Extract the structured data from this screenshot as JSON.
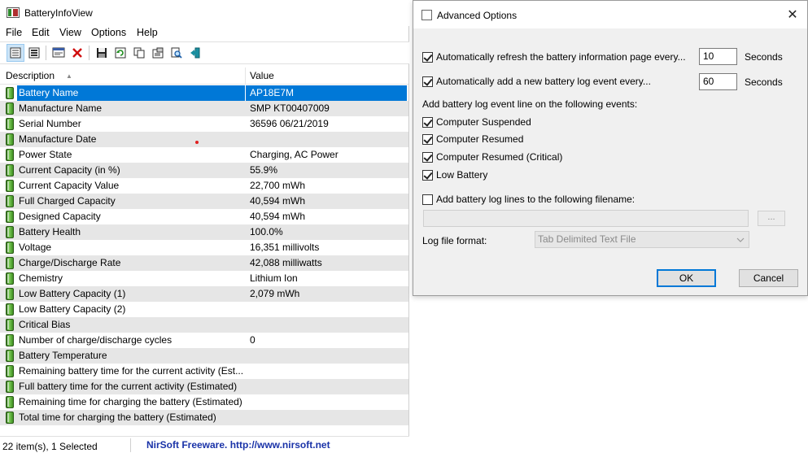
{
  "main_window": {
    "title": "BatteryInfoView",
    "menu": [
      "File",
      "Edit",
      "View",
      "Options",
      "Help"
    ],
    "toolbar_icons": [
      "properties-view-icon",
      "list-view-icon",
      "html-report-icon",
      "delete-icon",
      "save-icon",
      "refresh-icon",
      "copy-icon",
      "properties-icon",
      "find-icon",
      "exit-icon"
    ],
    "columns": {
      "description": "Description",
      "value": "Value"
    },
    "rows": [
      {
        "desc": "Battery Name",
        "value": "AP18E7M"
      },
      {
        "desc": "Manufacture Name",
        "value": "SMP KT00407009"
      },
      {
        "desc": "Serial Number",
        "value": "36596 06/21/2019"
      },
      {
        "desc": "Manufacture Date",
        "value": ""
      },
      {
        "desc": "Power State",
        "value": "Charging, AC Power"
      },
      {
        "desc": "Current Capacity (in %)",
        "value": "55.9%"
      },
      {
        "desc": "Current Capacity Value",
        "value": "22,700 mWh"
      },
      {
        "desc": "Full Charged Capacity",
        "value": "40,594 mWh"
      },
      {
        "desc": "Designed Capacity",
        "value": "40,594 mWh"
      },
      {
        "desc": "Battery Health",
        "value": "100.0%"
      },
      {
        "desc": "Voltage",
        "value": "16,351 millivolts"
      },
      {
        "desc": "Charge/Discharge Rate",
        "value": "42,088 milliwatts"
      },
      {
        "desc": "Chemistry",
        "value": "Lithium Ion"
      },
      {
        "desc": "Low Battery Capacity (1)",
        "value": "2,079 mWh"
      },
      {
        "desc": "Low Battery Capacity (2)",
        "value": ""
      },
      {
        "desc": "Critical Bias",
        "value": ""
      },
      {
        "desc": "Number of charge/discharge cycles",
        "value": "0"
      },
      {
        "desc": "Battery Temperature",
        "value": ""
      },
      {
        "desc": "Remaining battery time for the current activity (Est...",
        "value": ""
      },
      {
        "desc": "Full battery time for the current activity (Estimated)",
        "value": ""
      },
      {
        "desc": "Remaining time for charging the battery (Estimated)",
        "value": ""
      },
      {
        "desc": "Total  time for charging the battery (Estimated)",
        "value": ""
      }
    ],
    "selected_row": 0,
    "status": {
      "items": "22 item(s), 1 Selected",
      "link": "NirSoft Freeware.  http://www.nirsoft.net"
    }
  },
  "dialog": {
    "title": "Advanced Options",
    "auto_refresh": {
      "label": "Automatically refresh the battery information page every...",
      "checked": true,
      "value": "10",
      "unit": "Seconds"
    },
    "auto_log": {
      "label": "Automatically add a new battery log  event every...",
      "checked": true,
      "value": "60",
      "unit": "Seconds"
    },
    "events_heading": "Add battery log event line on the following events:",
    "events": [
      {
        "label": "Computer Suspended",
        "checked": true
      },
      {
        "label": "Computer Resumed",
        "checked": true
      },
      {
        "label": "Computer Resumed (Critical)",
        "checked": true
      },
      {
        "label": "Low Battery",
        "checked": true
      }
    ],
    "log_to_file": {
      "label": "Add battery log lines to the following filename:",
      "checked": false
    },
    "filename_value": "",
    "browse_label": "...",
    "format_label": "Log file format:",
    "format_value": "Tab Delimited Text File",
    "ok_label": "OK",
    "cancel_label": "Cancel"
  }
}
